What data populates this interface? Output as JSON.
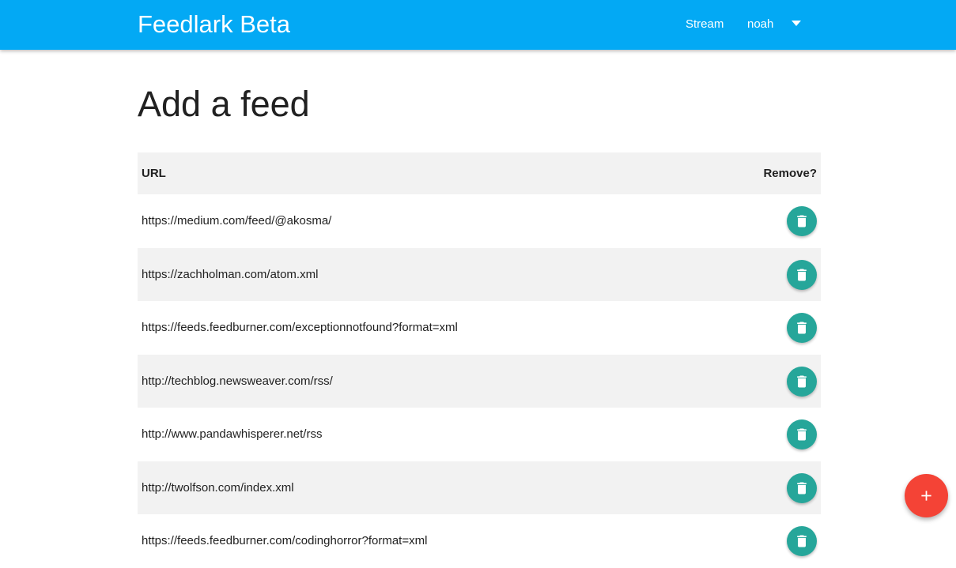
{
  "navbar": {
    "brand": "Feedlark Beta",
    "stream_label": "Stream",
    "user_label": "noah"
  },
  "main": {
    "title": "Add a feed",
    "table": {
      "headers": {
        "url": "URL",
        "remove": "Remove?"
      },
      "rows": [
        {
          "url": "https://medium.com/feed/@akosma/"
        },
        {
          "url": "https://zachholman.com/atom.xml"
        },
        {
          "url": "https://feeds.feedburner.com/exceptionnotfound?format=xml"
        },
        {
          "url": "http://techblog.newsweaver.com/rss/"
        },
        {
          "url": "http://www.pandawhisperer.net/rss"
        },
        {
          "url": "http://twolfson.com/index.xml"
        },
        {
          "url": "https://feeds.feedburner.com/codinghorror?format=xml"
        }
      ]
    }
  },
  "icons": {
    "delete": "trash-icon",
    "add": "plus-icon",
    "menu": "caret-down-icon"
  },
  "colors": {
    "navbar": "#03a9f4",
    "delete_button": "#26a69a",
    "fab": "#f44336",
    "row_stripe": "#f2f2f2"
  }
}
